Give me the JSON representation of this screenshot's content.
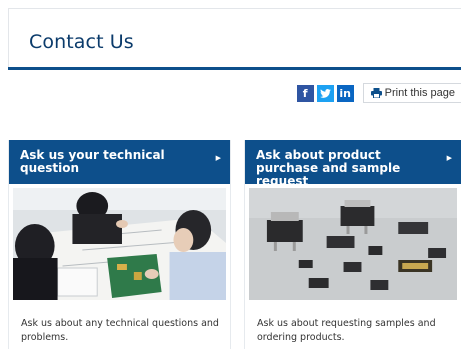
{
  "page": {
    "title": "Contact Us"
  },
  "share": {
    "facebook_glyph": "f",
    "twitter_glyph": "t",
    "linkedin_glyph": "in",
    "print_label": "Print this page",
    "colors": {
      "facebook": "#2f55a2",
      "twitter": "#1da1f2",
      "linkedin": "#0a66c2"
    }
  },
  "cards": [
    {
      "heading": "Ask us your technical question",
      "image_icon": "engineers-reviewing-circuit-board-photo",
      "description": "Ask us about any technical questions and problems."
    },
    {
      "heading": "Ask about product purchase and sample request",
      "image_icon": "semiconductor-components-photo",
      "description": "Ask us about requesting samples and ordering products."
    }
  ],
  "theme": {
    "brand_blue": "#0d4f8b",
    "title_color": "#0b3b6b"
  }
}
